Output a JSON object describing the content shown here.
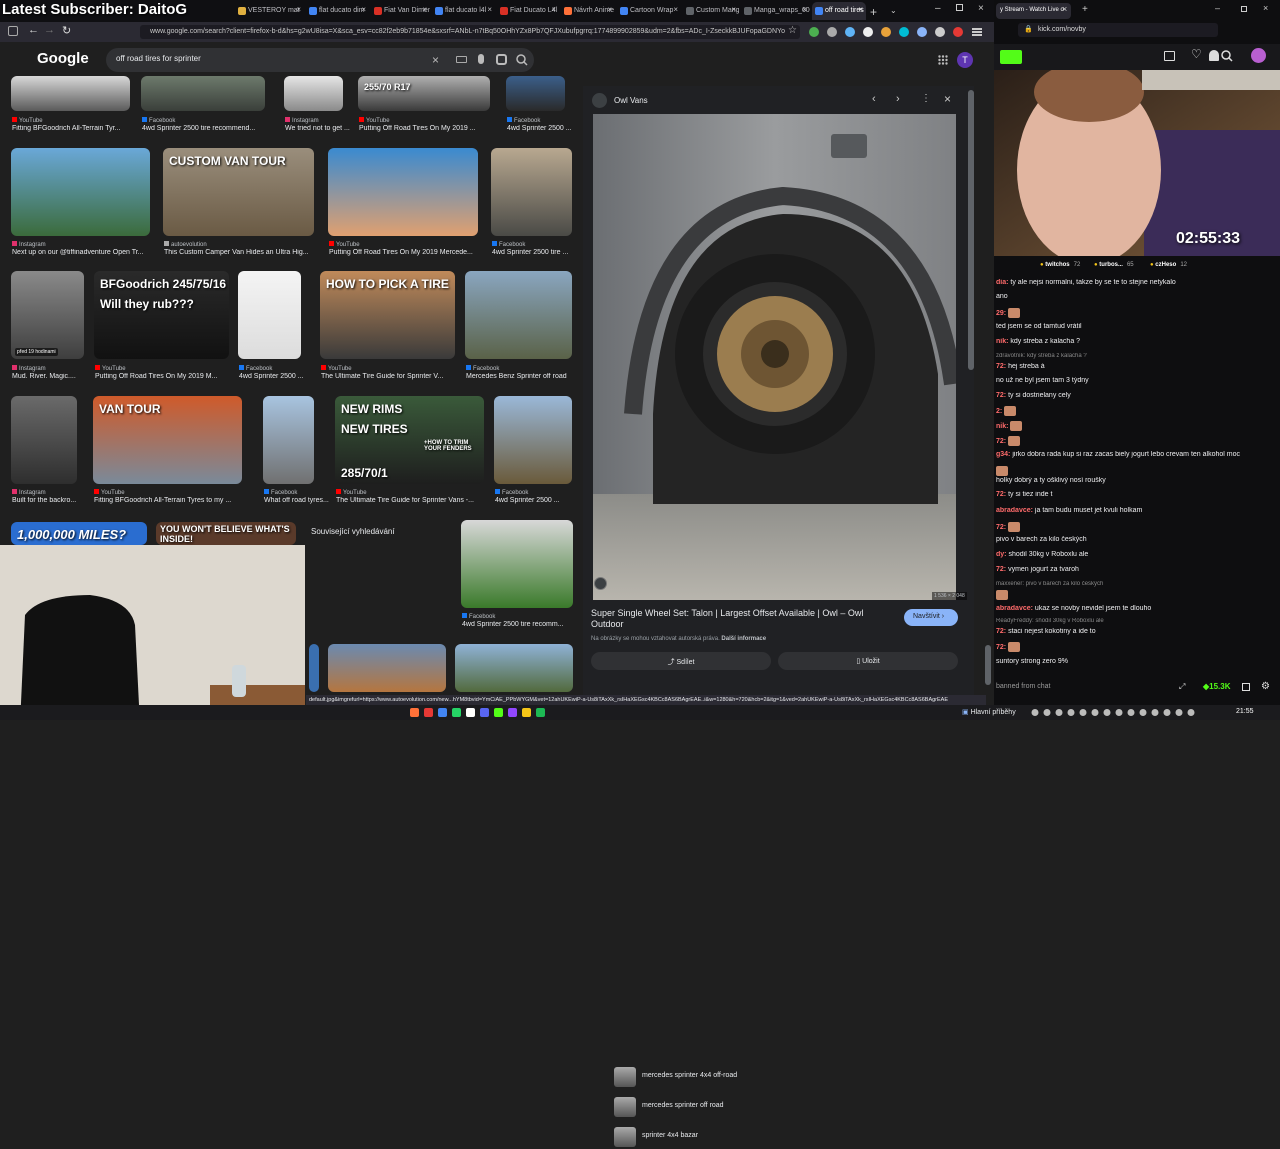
{
  "overlay_title": "Latest Subscriber: DaitoG",
  "tabs": [
    {
      "label": "VESTEROY mat",
      "color": "#e0b040"
    },
    {
      "label": "flat ducato dim",
      "color": "#4285f4"
    },
    {
      "label": "Fiat Van Dimen",
      "color": "#d93025"
    },
    {
      "label": "flat ducato l4l",
      "color": "#4285f4"
    },
    {
      "label": "Fiat Ducato L4l",
      "color": "#d93025"
    },
    {
      "label": "Návrh Anime M",
      "color": "#ff7139"
    },
    {
      "label": "Cartoon Wrap",
      "color": "#4285f4"
    },
    {
      "label": "Custom Manga",
      "color": "#5f6368"
    },
    {
      "label": "Manga_wraps_600",
      "color": "#5f6368"
    },
    {
      "label": "off road tires",
      "color": "#4285f4"
    }
  ],
  "url": "www.google.com/search?client=firefox-b-d&hs=g2wU8isa=X&sca_esv=cc82f2eb9b71854e&sxsrf=ANbL-n7tBq50OHhYZx8Pb7QFJXubufpgrrq:1774899902859&udm=2&fbs=ADc_I-ZseckkBJUFopaGDNYo",
  "google": {
    "logo": "Google",
    "query": "off road tires for sprinter",
    "avatar": "T"
  },
  "row0": [
    {
      "src": "YouTube",
      "cap": "Fitting BFGoodrich All-Terrain Tyr..."
    },
    {
      "src": "Facebook",
      "cap": "4wd Sprinter 2500 tire recommend..."
    },
    {
      "src": "Instagram",
      "cap": "We tried not to get ..."
    },
    {
      "src": "YouTube",
      "cap": "Putting Off Road Tires On My 2019 ...",
      "overlay": "255/70 R17"
    },
    {
      "src": "Facebook",
      "cap": "4wd Sprinter 2500 ..."
    }
  ],
  "row1": [
    {
      "src": "Instagram",
      "cap": "Next up on our @tiffinadventure Open Tr..."
    },
    {
      "src": "autoevolution",
      "cap": "This Custom Camper Van Hides an Ultra Hig...",
      "overlay": "CUSTOM VAN TOUR"
    },
    {
      "src": "YouTube",
      "cap": "Putting Off Road Tires On My 2019 Mercede..."
    },
    {
      "src": "Facebook",
      "cap": "4wd Sprinter 2500 tire ..."
    }
  ],
  "row2": [
    {
      "src": "Instagram",
      "cap": "Mud. River. Magic....",
      "badge": "před 19 hodinami"
    },
    {
      "src": "YouTube",
      "cap": "Putting Off Road Tires On My 2019 M...",
      "overlay": "BFGoodrich 245/75/16",
      "overlay2": "Will they rub???"
    },
    {
      "src": "Facebook",
      "cap": "4wd Sprinter 2500 ..."
    },
    {
      "src": "YouTube",
      "cap": "The Ultimate Tire Guide for Sprinter V...",
      "overlay": "HOW TO PICK A TIRE"
    },
    {
      "src": "Facebook",
      "cap": "Mercedes Benz Sprinter off road"
    }
  ],
  "row3": [
    {
      "src": "Instagram",
      "cap": "Built for the backro..."
    },
    {
      "src": "YouTube",
      "cap": "Fitting BFGoodrich All-Terrain Tyres to my ...",
      "overlay": "VAN TOUR"
    },
    {
      "src": "Facebook",
      "cap": "What off road tyres..."
    },
    {
      "src": "YouTube",
      "cap": "The Ultimate Tire Guide for Sprinter Vans -...",
      "overlay": "NEW RIMS",
      "overlay2": "NEW TIRES",
      "overlay3": "285/70/1",
      "overlay4": "+HOW TO TRIM YOUR FENDERS"
    },
    {
      "src": "Facebook",
      "cap": "4wd Sprinter 2500 ..."
    }
  ],
  "row4": {
    "t1": "1,000,000 MILES?",
    "t2": "YOU WON'T BELIEVE WHAT'S INSIDE!"
  },
  "related": {
    "title": "Související vyhledávání",
    "items": [
      "mercedes sprinter 4x4 off-road",
      "mercedes sprinter off road",
      "sprinter 4x4 bazar"
    ]
  },
  "right_tile": {
    "src": "Facebook",
    "cap": "4wd Sprinter 2500 tire recomm..."
  },
  "panel": {
    "site": "Owl Vans",
    "dims": "1 536 × 2 048",
    "title": "Super Single Wheel Set: Talon | Largest Offset Available | Owl – Owl Outdoor",
    "visit": "Navštívit",
    "note": "Na obrázky se mohou vztahovat autorská práva.",
    "more": "Další informace",
    "share": "Sdílet",
    "save": "Uložit"
  },
  "status_url": "default.jpg&imgrefurl=https://www.autoevolution.com/new...hYM8tbvid=YmCiAE_PPbWYGM&vet=12ahUKEwiP-a-Us8iTAxXk_rsIHaXEGsc4KBCc8AS6BAgrEAE..i&w=1280&h=720&hcb=2&itg=1&ved=2ahUKEwiP-a-Us8iTAxXk_rsIHaXEGsc4KBCc8AS6BAgrEAE",
  "kick": {
    "tab": "y Stream - Watch Live o",
    "url": "kick.com/novby",
    "timer": "02:55:33",
    "gifters": [
      {
        "name": "twitchos",
        "n": "72"
      },
      {
        "name": "turbos...",
        "n": "65"
      },
      {
        "name": "czHeso",
        "n": "12"
      }
    ],
    "messages": [
      {
        "u": "dia:",
        "t": "ty ale nejsi normalni, takze by se te to stejne netykalo"
      },
      {
        "u": "",
        "t": "ano"
      },
      {
        "u": "29:",
        "t": ""
      },
      {
        "u": "",
        "t": "ted jsem se od tamtud vrátil"
      },
      {
        "u": "nik:",
        "t": "kdy streba z kalacha ?"
      },
      {
        "u": "",
        "t": "zdravotník: kdy streba z kalacha ?",
        "muted": true
      },
      {
        "u": "72:",
        "t": "hej streba á"
      },
      {
        "u": "",
        "t": "no už ne byl jsem tam 3 týdny"
      },
      {
        "u": "72:",
        "t": "ty si dostrielany cely"
      },
      {
        "u": "2:",
        "t": ""
      },
      {
        "u": "nik:",
        "t": ""
      },
      {
        "u": "72:",
        "t": ""
      },
      {
        "u": "g34:",
        "t": "jirko dobra rada kup si raz zacas biely jogurt lebo crevam ten alkohol moc"
      },
      {
        "u": "",
        "t": ""
      },
      {
        "u": "",
        "t": "holky dobrý a ty ošklivý nosí roušky"
      },
      {
        "u": "72:",
        "t": "ty si tiez inde t"
      },
      {
        "u": "abradavce:",
        "t": "ja tam budu muset jet kvuli holkam"
      },
      {
        "u": "72:",
        "t": ""
      },
      {
        "u": "",
        "t": "pivo v barech za kilo českých"
      },
      {
        "u": "dy:",
        "t": "shodil 30kg v Roboxlu ale"
      },
      {
        "u": "72:",
        "t": "vymen jogurt za tvaroh"
      },
      {
        "u": "",
        "t": "maxxener: pivo v barech za kilo českých",
        "muted": true
      },
      {
        "u": "",
        "t": ""
      },
      {
        "u": "abradavce:",
        "t": "ukaz se novby nevidel jsem te dlouho"
      },
      {
        "u": "",
        "t": "ReadyFreddy: shodil 30kg v Roboxlu ale",
        "muted": true
      },
      {
        "u": "72:",
        "t": "staci nejest kokotiny a ide to"
      },
      {
        "u": "72:",
        "t": ""
      },
      {
        "u": "",
        "t": "suntory strong zero 9%"
      }
    ],
    "placeholder": "banned from chat",
    "viewers": "15.3K"
  },
  "taskbar": {
    "news": "Hlavní příběhy",
    "time": "21:55"
  }
}
